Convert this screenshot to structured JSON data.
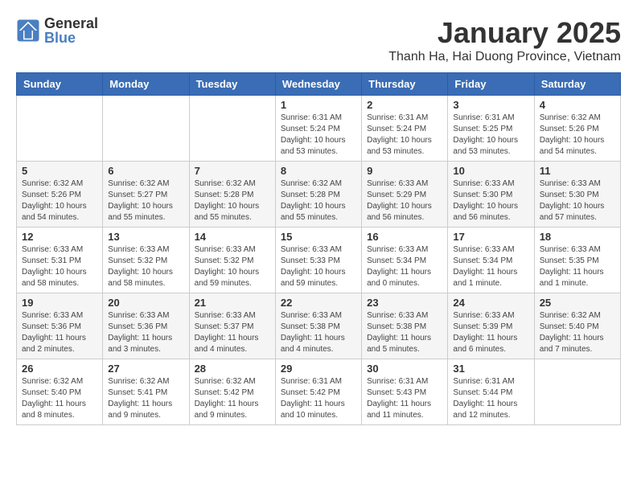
{
  "logo": {
    "general": "General",
    "blue": "Blue"
  },
  "title": "January 2025",
  "subtitle": "Thanh Ha, Hai Duong Province, Vietnam",
  "headers": [
    "Sunday",
    "Monday",
    "Tuesday",
    "Wednesday",
    "Thursday",
    "Friday",
    "Saturday"
  ],
  "weeks": [
    [
      {
        "day": "",
        "info": ""
      },
      {
        "day": "",
        "info": ""
      },
      {
        "day": "",
        "info": ""
      },
      {
        "day": "1",
        "info": "Sunrise: 6:31 AM\nSunset: 5:24 PM\nDaylight: 10 hours\nand 53 minutes."
      },
      {
        "day": "2",
        "info": "Sunrise: 6:31 AM\nSunset: 5:24 PM\nDaylight: 10 hours\nand 53 minutes."
      },
      {
        "day": "3",
        "info": "Sunrise: 6:31 AM\nSunset: 5:25 PM\nDaylight: 10 hours\nand 53 minutes."
      },
      {
        "day": "4",
        "info": "Sunrise: 6:32 AM\nSunset: 5:26 PM\nDaylight: 10 hours\nand 54 minutes."
      }
    ],
    [
      {
        "day": "5",
        "info": "Sunrise: 6:32 AM\nSunset: 5:26 PM\nDaylight: 10 hours\nand 54 minutes."
      },
      {
        "day": "6",
        "info": "Sunrise: 6:32 AM\nSunset: 5:27 PM\nDaylight: 10 hours\nand 55 minutes."
      },
      {
        "day": "7",
        "info": "Sunrise: 6:32 AM\nSunset: 5:28 PM\nDaylight: 10 hours\nand 55 minutes."
      },
      {
        "day": "8",
        "info": "Sunrise: 6:32 AM\nSunset: 5:28 PM\nDaylight: 10 hours\nand 55 minutes."
      },
      {
        "day": "9",
        "info": "Sunrise: 6:33 AM\nSunset: 5:29 PM\nDaylight: 10 hours\nand 56 minutes."
      },
      {
        "day": "10",
        "info": "Sunrise: 6:33 AM\nSunset: 5:30 PM\nDaylight: 10 hours\nand 56 minutes."
      },
      {
        "day": "11",
        "info": "Sunrise: 6:33 AM\nSunset: 5:30 PM\nDaylight: 10 hours\nand 57 minutes."
      }
    ],
    [
      {
        "day": "12",
        "info": "Sunrise: 6:33 AM\nSunset: 5:31 PM\nDaylight: 10 hours\nand 58 minutes."
      },
      {
        "day": "13",
        "info": "Sunrise: 6:33 AM\nSunset: 5:32 PM\nDaylight: 10 hours\nand 58 minutes."
      },
      {
        "day": "14",
        "info": "Sunrise: 6:33 AM\nSunset: 5:32 PM\nDaylight: 10 hours\nand 59 minutes."
      },
      {
        "day": "15",
        "info": "Sunrise: 6:33 AM\nSunset: 5:33 PM\nDaylight: 10 hours\nand 59 minutes."
      },
      {
        "day": "16",
        "info": "Sunrise: 6:33 AM\nSunset: 5:34 PM\nDaylight: 11 hours\nand 0 minutes."
      },
      {
        "day": "17",
        "info": "Sunrise: 6:33 AM\nSunset: 5:34 PM\nDaylight: 11 hours\nand 1 minute."
      },
      {
        "day": "18",
        "info": "Sunrise: 6:33 AM\nSunset: 5:35 PM\nDaylight: 11 hours\nand 1 minute."
      }
    ],
    [
      {
        "day": "19",
        "info": "Sunrise: 6:33 AM\nSunset: 5:36 PM\nDaylight: 11 hours\nand 2 minutes."
      },
      {
        "day": "20",
        "info": "Sunrise: 6:33 AM\nSunset: 5:36 PM\nDaylight: 11 hours\nand 3 minutes."
      },
      {
        "day": "21",
        "info": "Sunrise: 6:33 AM\nSunset: 5:37 PM\nDaylight: 11 hours\nand 4 minutes."
      },
      {
        "day": "22",
        "info": "Sunrise: 6:33 AM\nSunset: 5:38 PM\nDaylight: 11 hours\nand 4 minutes."
      },
      {
        "day": "23",
        "info": "Sunrise: 6:33 AM\nSunset: 5:38 PM\nDaylight: 11 hours\nand 5 minutes."
      },
      {
        "day": "24",
        "info": "Sunrise: 6:33 AM\nSunset: 5:39 PM\nDaylight: 11 hours\nand 6 minutes."
      },
      {
        "day": "25",
        "info": "Sunrise: 6:32 AM\nSunset: 5:40 PM\nDaylight: 11 hours\nand 7 minutes."
      }
    ],
    [
      {
        "day": "26",
        "info": "Sunrise: 6:32 AM\nSunset: 5:40 PM\nDaylight: 11 hours\nand 8 minutes."
      },
      {
        "day": "27",
        "info": "Sunrise: 6:32 AM\nSunset: 5:41 PM\nDaylight: 11 hours\nand 9 minutes."
      },
      {
        "day": "28",
        "info": "Sunrise: 6:32 AM\nSunset: 5:42 PM\nDaylight: 11 hours\nand 9 minutes."
      },
      {
        "day": "29",
        "info": "Sunrise: 6:31 AM\nSunset: 5:42 PM\nDaylight: 11 hours\nand 10 minutes."
      },
      {
        "day": "30",
        "info": "Sunrise: 6:31 AM\nSunset: 5:43 PM\nDaylight: 11 hours\nand 11 minutes."
      },
      {
        "day": "31",
        "info": "Sunrise: 6:31 AM\nSunset: 5:44 PM\nDaylight: 11 hours\nand 12 minutes."
      },
      {
        "day": "",
        "info": ""
      }
    ]
  ]
}
